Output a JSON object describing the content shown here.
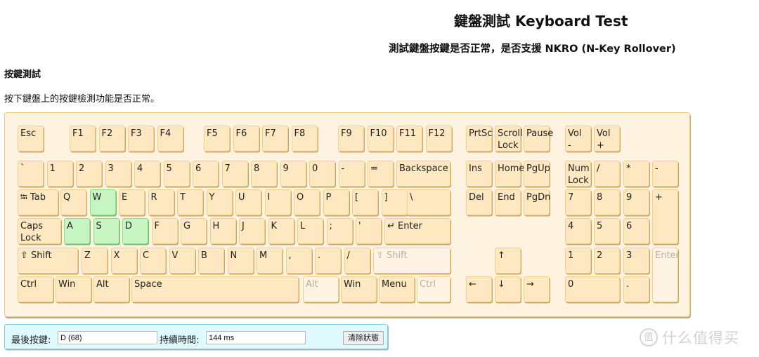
{
  "header": {
    "title": "鍵盤測試 Keyboard Test",
    "subtitle": "測試鍵盤按鍵是否正常，是否支援 NKRO (N-Key Rollover)"
  },
  "section": {
    "title": "按鍵測試",
    "description": "按下鍵盤上的按鍵檢測功能是否正常。"
  },
  "colors": {
    "key_default": "#fee8c1",
    "key_pressed": "#c6f5c2",
    "key_inactive": "#fff4e4",
    "keyboard_bg": "#fef3e0",
    "status_bg": "#dffbfd"
  },
  "keys": [
    {
      "id": "esc",
      "label": "Esc",
      "state": "default"
    },
    {
      "id": "f1",
      "label": "F1",
      "state": "default"
    },
    {
      "id": "f2",
      "label": "F2",
      "state": "default"
    },
    {
      "id": "f3",
      "label": "F3",
      "state": "default"
    },
    {
      "id": "f4",
      "label": "F4",
      "state": "default"
    },
    {
      "id": "f5",
      "label": "F5",
      "state": "default"
    },
    {
      "id": "f6",
      "label": "F6",
      "state": "default"
    },
    {
      "id": "f7",
      "label": "F7",
      "state": "default"
    },
    {
      "id": "f8",
      "label": "F8",
      "state": "default"
    },
    {
      "id": "f9",
      "label": "F9",
      "state": "default"
    },
    {
      "id": "f10",
      "label": "F10",
      "state": "default"
    },
    {
      "id": "f11",
      "label": "F11",
      "state": "default"
    },
    {
      "id": "f12",
      "label": "F12",
      "state": "default"
    },
    {
      "id": "prtsc",
      "label": "PrtSc",
      "state": "default"
    },
    {
      "id": "scroll-lock",
      "label": "Scroll\nLock",
      "state": "default"
    },
    {
      "id": "pause",
      "label": "Pause",
      "state": "default"
    },
    {
      "id": "vol-down",
      "label": "Vol\n-",
      "state": "default"
    },
    {
      "id": "vol-up",
      "label": "Vol\n+",
      "state": "default"
    },
    {
      "id": "backtick",
      "label": "`",
      "state": "default"
    },
    {
      "id": "1",
      "label": "1",
      "state": "default"
    },
    {
      "id": "2",
      "label": "2",
      "state": "default"
    },
    {
      "id": "3",
      "label": "3",
      "state": "default"
    },
    {
      "id": "4",
      "label": "4",
      "state": "default"
    },
    {
      "id": "5",
      "label": "5",
      "state": "default"
    },
    {
      "id": "6",
      "label": "6",
      "state": "default"
    },
    {
      "id": "7",
      "label": "7",
      "state": "default"
    },
    {
      "id": "8",
      "label": "8",
      "state": "default"
    },
    {
      "id": "9",
      "label": "9",
      "state": "default"
    },
    {
      "id": "0",
      "label": "0",
      "state": "default"
    },
    {
      "id": "minus",
      "label": "-",
      "state": "default"
    },
    {
      "id": "equals",
      "label": "=",
      "state": "default"
    },
    {
      "id": "backspace",
      "label": "Backspace",
      "state": "default"
    },
    {
      "id": "ins",
      "label": "Ins",
      "state": "default"
    },
    {
      "id": "home",
      "label": "Home",
      "state": "default"
    },
    {
      "id": "pgup",
      "label": "PgUp",
      "state": "default"
    },
    {
      "id": "numlock",
      "label": "Num\nLock",
      "state": "default"
    },
    {
      "id": "num-divide",
      "label": "/",
      "state": "default"
    },
    {
      "id": "num-multiply",
      "label": "*",
      "state": "default"
    },
    {
      "id": "num-minus",
      "label": "-",
      "state": "default"
    },
    {
      "id": "tab",
      "label": "⭾ Tab",
      "state": "default"
    },
    {
      "id": "q",
      "label": "Q",
      "state": "default"
    },
    {
      "id": "w",
      "label": "W",
      "state": "pressed"
    },
    {
      "id": "e",
      "label": "E",
      "state": "default"
    },
    {
      "id": "r",
      "label": "R",
      "state": "default"
    },
    {
      "id": "t",
      "label": "T",
      "state": "default"
    },
    {
      "id": "y",
      "label": "Y",
      "state": "default"
    },
    {
      "id": "u",
      "label": "U",
      "state": "default"
    },
    {
      "id": "i",
      "label": "I",
      "state": "default"
    },
    {
      "id": "o",
      "label": "O",
      "state": "default"
    },
    {
      "id": "p",
      "label": "P",
      "state": "default"
    },
    {
      "id": "lbracket",
      "label": "[",
      "state": "default"
    },
    {
      "id": "rbracket",
      "label": "]",
      "state": "default"
    },
    {
      "id": "backslash",
      "label": "\\",
      "state": "default"
    },
    {
      "id": "del",
      "label": "Del",
      "state": "default"
    },
    {
      "id": "end",
      "label": "End",
      "state": "default"
    },
    {
      "id": "pgdn",
      "label": "PgDn",
      "state": "default"
    },
    {
      "id": "num7",
      "label": "7",
      "state": "default"
    },
    {
      "id": "num8",
      "label": "8",
      "state": "default"
    },
    {
      "id": "num9",
      "label": "9",
      "state": "default"
    },
    {
      "id": "num-plus",
      "label": "+",
      "state": "default"
    },
    {
      "id": "capslock",
      "label": "Caps\nLock",
      "state": "default"
    },
    {
      "id": "a",
      "label": "A",
      "state": "pressed"
    },
    {
      "id": "s",
      "label": "S",
      "state": "pressed"
    },
    {
      "id": "d",
      "label": "D",
      "state": "pressed"
    },
    {
      "id": "f",
      "label": "F",
      "state": "default"
    },
    {
      "id": "g",
      "label": "G",
      "state": "default"
    },
    {
      "id": "h",
      "label": "H",
      "state": "default"
    },
    {
      "id": "j",
      "label": "J",
      "state": "default"
    },
    {
      "id": "k",
      "label": "K",
      "state": "default"
    },
    {
      "id": "l",
      "label": "L",
      "state": "default"
    },
    {
      "id": "semicolon",
      "label": ";",
      "state": "default"
    },
    {
      "id": "quote",
      "label": "'",
      "state": "default"
    },
    {
      "id": "enter",
      "label": "↵ Enter",
      "state": "default"
    },
    {
      "id": "num4",
      "label": "4",
      "state": "default"
    },
    {
      "id": "num5",
      "label": "5",
      "state": "default"
    },
    {
      "id": "num6",
      "label": "6",
      "state": "default"
    },
    {
      "id": "lshift",
      "label": "⇧ Shift",
      "state": "default"
    },
    {
      "id": "z",
      "label": "Z",
      "state": "default"
    },
    {
      "id": "x",
      "label": "X",
      "state": "default"
    },
    {
      "id": "c",
      "label": "C",
      "state": "default"
    },
    {
      "id": "v",
      "label": "V",
      "state": "default"
    },
    {
      "id": "b",
      "label": "B",
      "state": "default"
    },
    {
      "id": "n",
      "label": "N",
      "state": "default"
    },
    {
      "id": "m",
      "label": "M",
      "state": "default"
    },
    {
      "id": "comma",
      "label": ",",
      "state": "default"
    },
    {
      "id": "period",
      "label": ".",
      "state": "default"
    },
    {
      "id": "slash",
      "label": "/",
      "state": "default"
    },
    {
      "id": "rshift",
      "label": "⇧ Shift",
      "state": "inactive"
    },
    {
      "id": "up",
      "label": "↑",
      "state": "default"
    },
    {
      "id": "num1",
      "label": "1",
      "state": "default"
    },
    {
      "id": "num2",
      "label": "2",
      "state": "default"
    },
    {
      "id": "num3",
      "label": "3",
      "state": "default"
    },
    {
      "id": "num-enter",
      "label": "Enter",
      "state": "inactive"
    },
    {
      "id": "lctrl",
      "label": "Ctrl",
      "state": "default"
    },
    {
      "id": "lwin",
      "label": "Win",
      "state": "default"
    },
    {
      "id": "lalt",
      "label": "Alt",
      "state": "default"
    },
    {
      "id": "space",
      "label": "Space",
      "state": "default"
    },
    {
      "id": "ralt",
      "label": "Alt",
      "state": "inactive"
    },
    {
      "id": "rwin",
      "label": "Win",
      "state": "default"
    },
    {
      "id": "menu",
      "label": "Menu",
      "state": "default"
    },
    {
      "id": "rctrl",
      "label": "Ctrl",
      "state": "inactive"
    },
    {
      "id": "left",
      "label": "←",
      "state": "default"
    },
    {
      "id": "down",
      "label": "↓",
      "state": "default"
    },
    {
      "id": "right",
      "label": "→",
      "state": "default"
    },
    {
      "id": "num0",
      "label": "0",
      "state": "default"
    },
    {
      "id": "num-decimal",
      "label": ".",
      "state": "default"
    }
  ],
  "status": {
    "last_key_label": "最後按鍵:",
    "last_key_value": "D (68)",
    "duration_label": "持續時間:",
    "duration_value": "144 ms",
    "clear_button": "清除狀態"
  },
  "watermark": {
    "logo": "值",
    "text": "什么值得买"
  }
}
